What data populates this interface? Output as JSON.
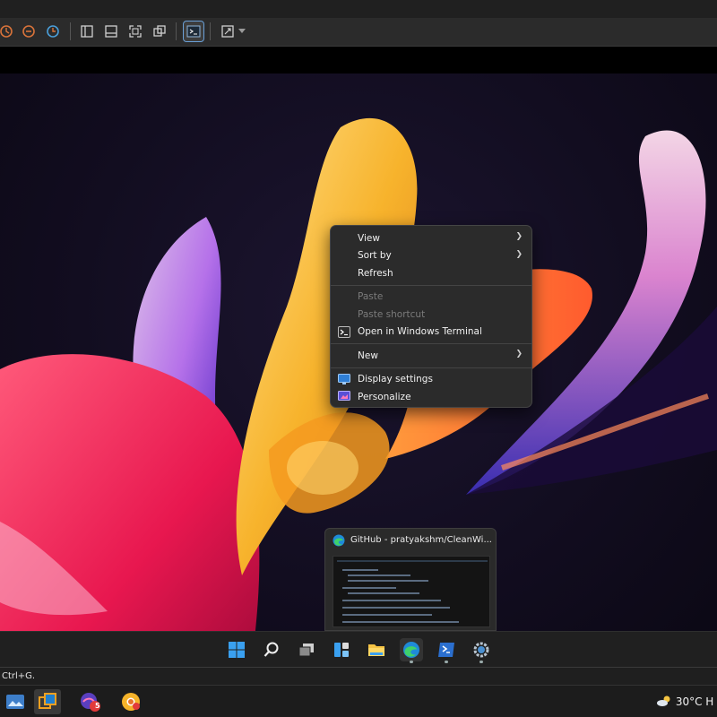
{
  "host_status": {
    "hint": "Ctrl+G."
  },
  "context_menu": {
    "items": [
      {
        "label": "View",
        "has_submenu": true
      },
      {
        "label": "Sort by",
        "has_submenu": true
      },
      {
        "label": "Refresh"
      },
      {
        "label": "Paste",
        "disabled": true
      },
      {
        "label": "Paste shortcut",
        "disabled": true
      },
      {
        "label": "Open in Windows Terminal",
        "icon": "terminal-icon"
      },
      {
        "label": "New",
        "has_submenu": true
      },
      {
        "label": "Display settings",
        "icon": "display-icon"
      },
      {
        "label": "Personalize",
        "icon": "personalize-icon"
      }
    ]
  },
  "taskbar_preview": {
    "title": "GitHub - pratyakshm/CleanWi..."
  },
  "guest_taskbar": {
    "icons": [
      "start-icon",
      "search-icon",
      "task-view-icon",
      "widgets-icon",
      "file-explorer-icon",
      "edge-icon",
      "terminal-icon",
      "settings-icon"
    ]
  },
  "host_taskbar": {
    "icons": [
      "photos-icon",
      "virtualbox-icon",
      "badge-app-icon",
      "chrome-canary-icon"
    ],
    "badge_count": "5",
    "weather": "30°C  H"
  },
  "colors": {
    "accent": "#6aa0d8",
    "menu_bg": "#2b2b2b",
    "taskbar_bg": "#202020"
  }
}
